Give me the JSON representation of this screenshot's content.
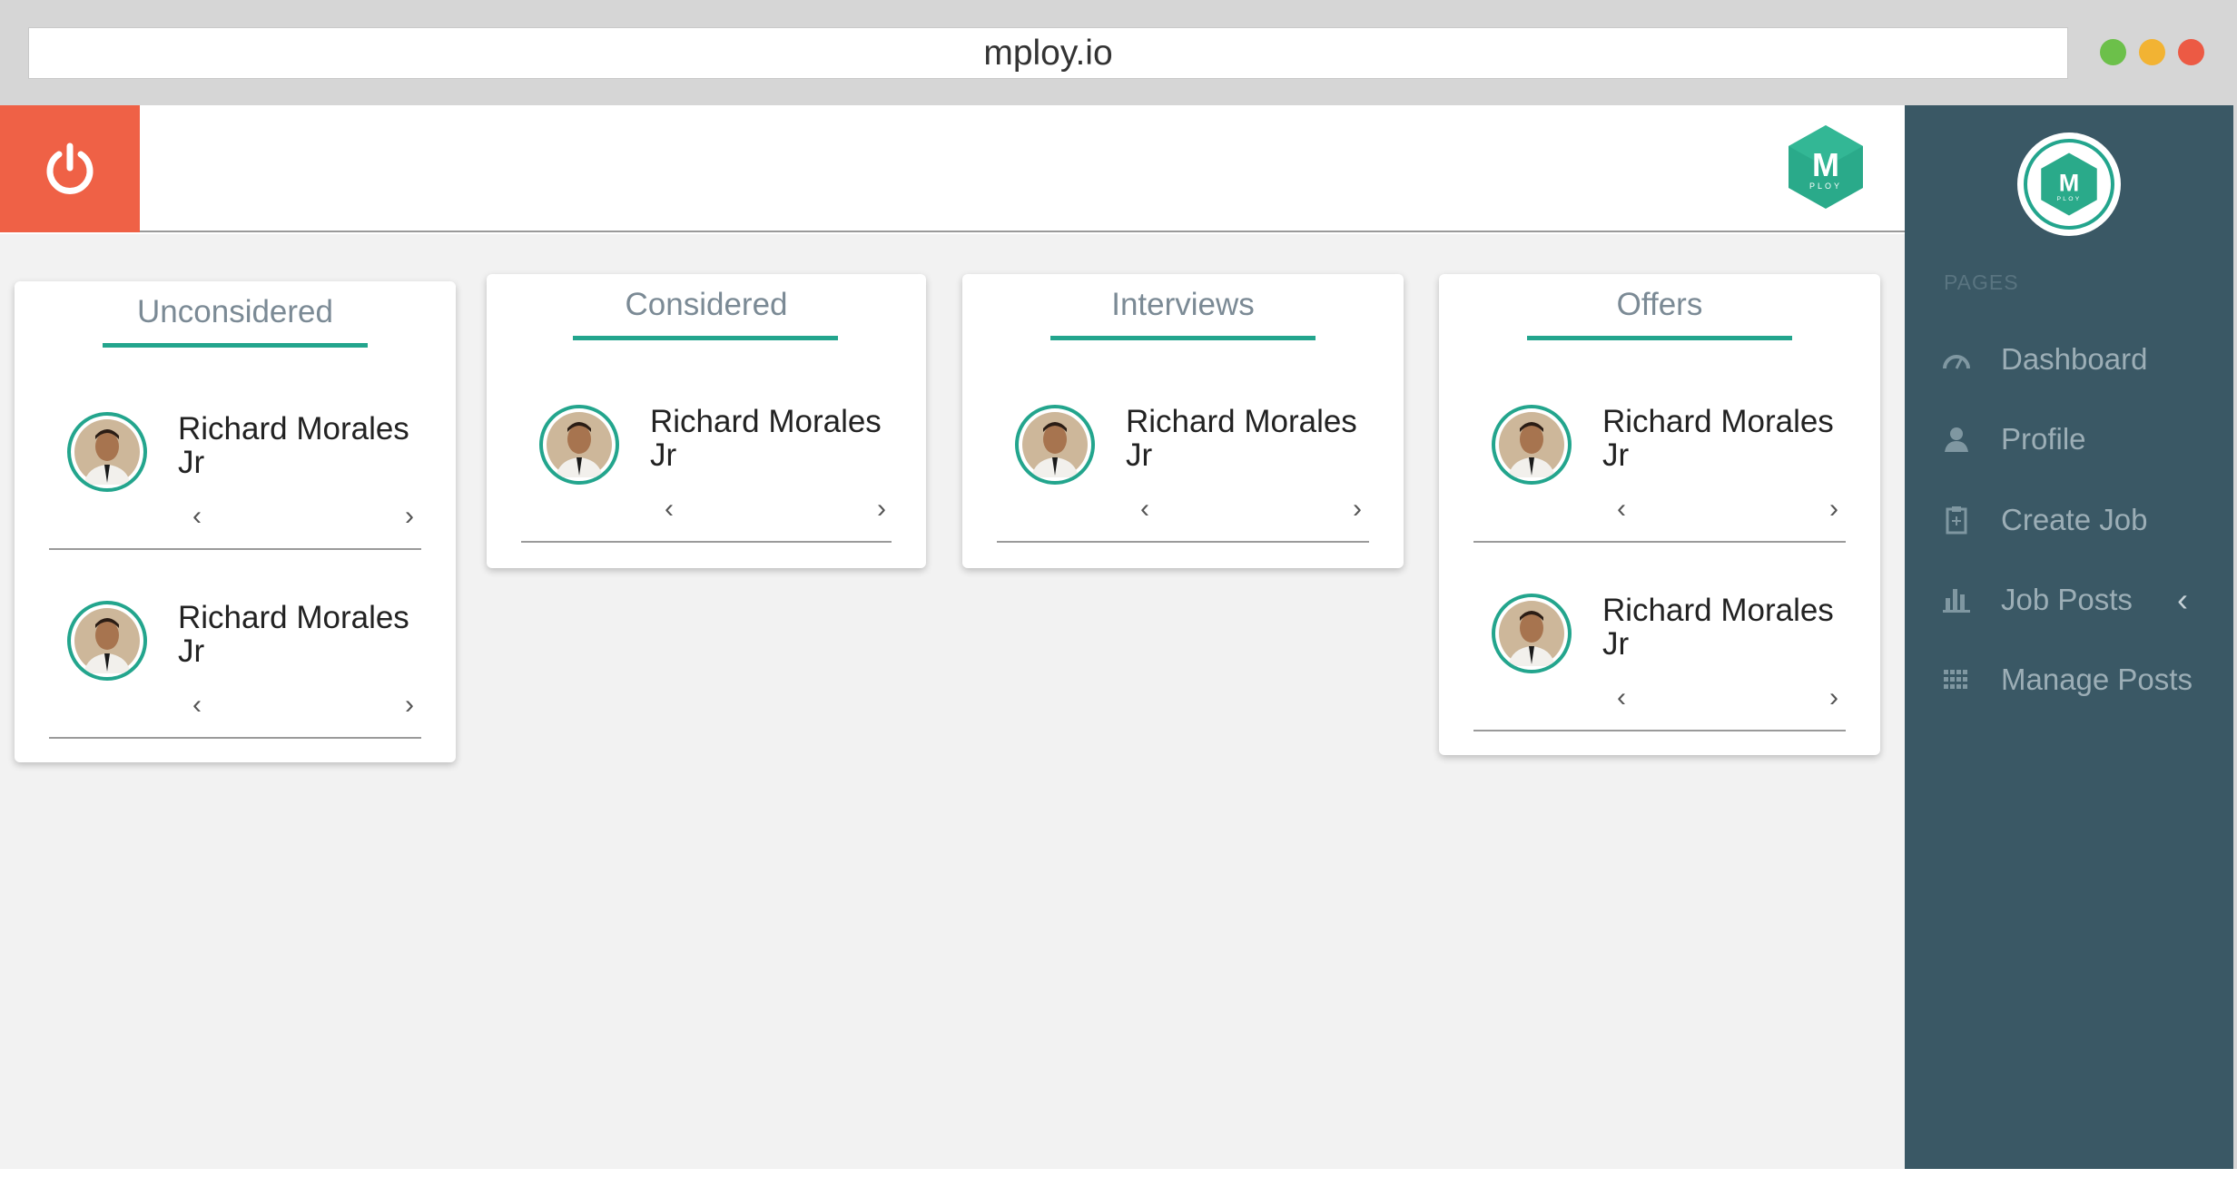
{
  "browser": {
    "url": "mploy.io",
    "dots": [
      {
        "name": "green-dot",
        "color": "#6cc04a"
      },
      {
        "name": "yellow-dot",
        "color": "#f2b333"
      },
      {
        "name": "red-dot",
        "color": "#ec5a44"
      }
    ]
  },
  "app": {
    "power_icon": "power-icon",
    "logo_icon": "mploy-hex-logo-icon",
    "logo_letter": "M",
    "logo_text": "PLOY",
    "colors": {
      "accent": "#23a58d",
      "power": "#ef6146",
      "sidebar": "#3a5865"
    }
  },
  "board": {
    "columns": [
      {
        "title": "Unconsidered",
        "candidates": [
          {
            "name": "Richard Morales Jr"
          },
          {
            "name": "Richard Morales Jr"
          }
        ]
      },
      {
        "title": "Considered",
        "candidates": [
          {
            "name": "Richard Morales Jr"
          }
        ]
      },
      {
        "title": "Interviews",
        "candidates": [
          {
            "name": "Richard Morales Jr"
          }
        ]
      },
      {
        "title": "Offers",
        "candidates": [
          {
            "name": "Richard Morales Jr"
          },
          {
            "name": "Richard Morales Jr"
          }
        ]
      }
    ],
    "prev_glyph": "‹",
    "next_glyph": "›"
  },
  "sidebar": {
    "section_label": "PAGES",
    "items": [
      {
        "label": "Dashboard",
        "icon": "gauge-icon"
      },
      {
        "label": "Profile",
        "icon": "user-icon"
      },
      {
        "label": "Create Job",
        "icon": "clipboard-icon"
      },
      {
        "label": "Job Posts",
        "icon": "bar-chart-icon",
        "chevron": "‹"
      },
      {
        "label": "Manage Posts",
        "icon": "grid-icon"
      }
    ]
  }
}
